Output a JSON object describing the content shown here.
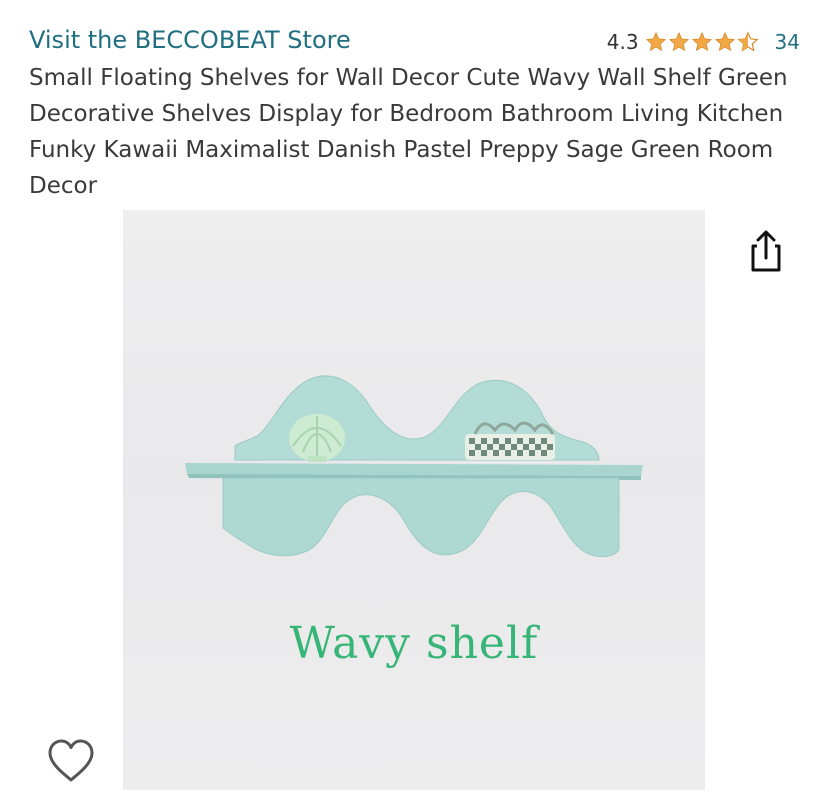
{
  "store": {
    "link_text": "Visit the BECCOBEAT Store"
  },
  "rating": {
    "value": "4.3",
    "stars": 4.3,
    "count": "34",
    "star_color": "#f3a847"
  },
  "product": {
    "title": "Small Floating Shelves for Wall Decor Cute Wavy Wall Shelf Green Decorative Shelves Display for Bedroom Bathroom Living Kitchen Funky Kawaii Maximalist Danish Pastel Preppy Sage Green Room Decor",
    "image_caption": "Wavy shelf"
  },
  "icons": {
    "share": "share-icon",
    "wishlist": "heart-icon",
    "star": "star-icon"
  },
  "colors": {
    "link": "#1f6f80",
    "shelf": "#a9d8d2",
    "caption": "#37b576"
  }
}
